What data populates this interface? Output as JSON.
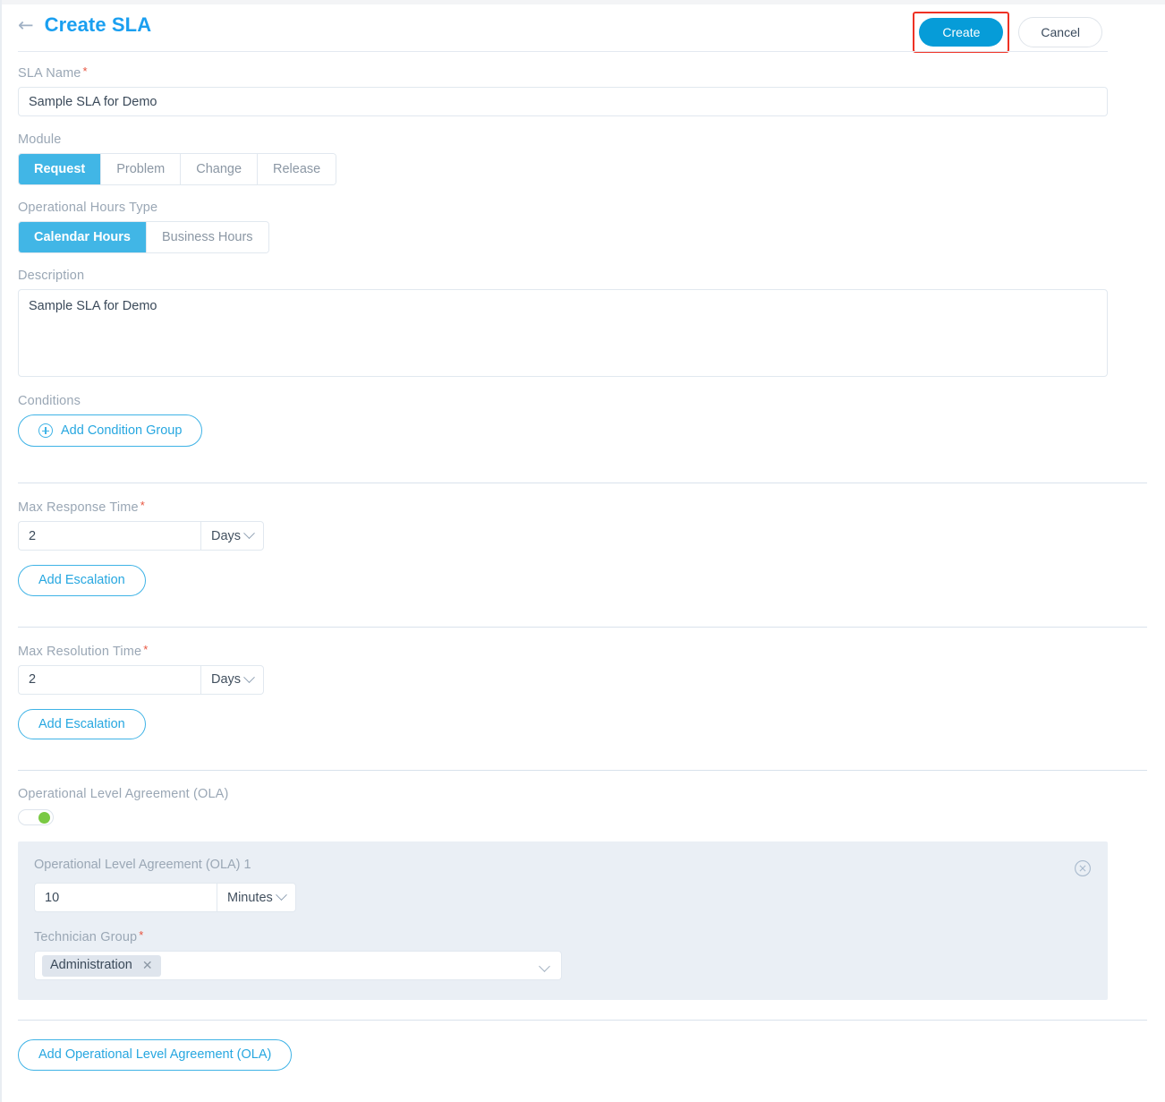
{
  "header": {
    "back_icon": "arrow-left-icon",
    "title": "Create SLA",
    "create_label": "Create",
    "cancel_label": "Cancel",
    "highlight_color": "#ee3124",
    "create_color": "#069cd8",
    "title_color": "#1a9ff0"
  },
  "sla_name": {
    "label": "SLA Name",
    "required": "*",
    "value": "Sample SLA for Demo"
  },
  "module": {
    "label": "Module",
    "options": [
      "Request",
      "Problem",
      "Change",
      "Release"
    ],
    "selected": "Request"
  },
  "operational_hours_type": {
    "label": "Operational Hours Type",
    "options": [
      "Calendar Hours",
      "Business Hours"
    ],
    "selected": "Calendar Hours"
  },
  "description": {
    "label": "Description",
    "value": "Sample SLA for Demo"
  },
  "conditions": {
    "label": "Conditions",
    "add_group_label": "Add Condition Group",
    "add_group_icon": "plus-circle-icon"
  },
  "max_response_time": {
    "label": "Max Response Time",
    "required": "*",
    "value": "2",
    "unit": "Days",
    "escalation_label": "Add Escalation"
  },
  "max_resolution_time": {
    "label": "Max Resolution Time",
    "required": "*",
    "value": "2",
    "unit": "Days",
    "escalation_label": "Add Escalation"
  },
  "ola": {
    "label": "Operational Level Agreement (OLA)",
    "toggle_state": "on",
    "toggle_color": "#7ac943",
    "card": {
      "title": "Operational Level Agreement (OLA) 1",
      "close_icon": "close-circle-icon",
      "value": "10",
      "unit": "Minutes",
      "technician_group": {
        "label": "Technician Group",
        "required": "*",
        "chips": [
          "Administration"
        ],
        "chip_remove_icon": "close-icon",
        "dropdown_icon": "chevron-down-icon"
      }
    },
    "add_label": "Add Operational Level Agreement (OLA)"
  }
}
